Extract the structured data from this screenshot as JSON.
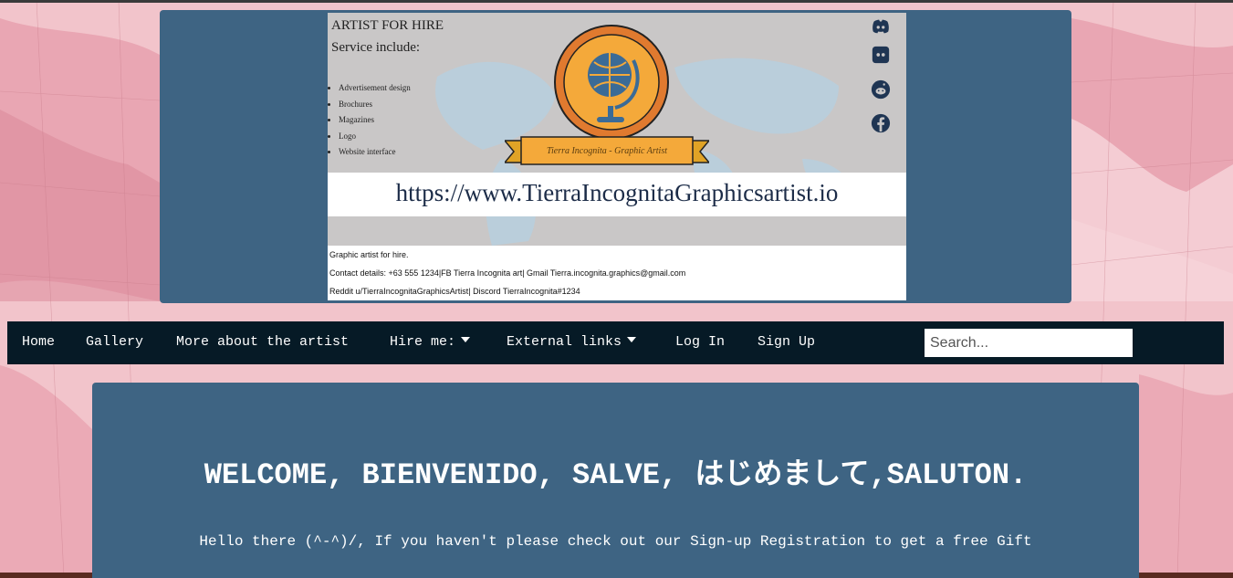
{
  "banner": {
    "title": "ARTIST FOR HIRE",
    "service_heading": "Service include:",
    "services": [
      "Advertisement design",
      "Brochures",
      "Magazines",
      "Logo",
      "Website interface"
    ],
    "brand": "Tierra Incognita - Graphic Artist",
    "url": "https://www.TierraIncognitaGraphicsartist.io",
    "contact_lines": [
      "Graphic artist for hire.",
      "Contact details: +63 555 1234|FB Tierra Incognita art| Gmail Tierra.incognita.graphics@gmail.com",
      "Reddit u/TierraIncognitaGraphicsArtist| Discord TierraIncognita#1234"
    ],
    "social_icons": [
      "discord-icon",
      "discord-icon",
      "reddit-icon",
      "facebook-icon"
    ]
  },
  "nav": {
    "items": [
      {
        "label": "Home"
      },
      {
        "label": "Gallery"
      },
      {
        "label": "More about the artist"
      },
      {
        "label": "Hire me:"
      },
      {
        "label": "External links"
      },
      {
        "label": "Log In"
      },
      {
        "label": "Sign Up"
      }
    ],
    "search_placeholder": "Search..."
  },
  "content": {
    "welcome": "WELCOME, BIENVENIDO, SALVE, はじめまして,SALUTON.",
    "hello": "Hello there (^-^)/, If you haven't please check out our Sign-up Registration to get a free Gift"
  },
  "colors": {
    "panel": "#3e6483",
    "nav_bg": "#061a26",
    "map_pink": "#eeb3bc",
    "banner_gray": "#c9c7c7",
    "globe_orange": "#e07a2f",
    "globe_yellow": "#f4a93a",
    "globe_blue": "#3b6b96"
  }
}
